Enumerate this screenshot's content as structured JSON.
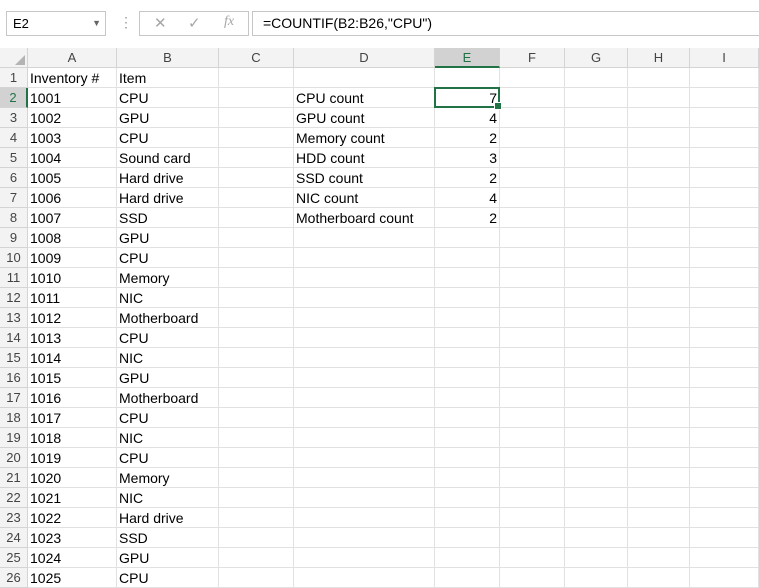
{
  "name_box": "E2",
  "formula_bar": {
    "cancel_icon": "✕",
    "enter_icon": "✓",
    "fx_label": "fx",
    "formula": "=COUNTIF(B2:B26,\"CPU\")"
  },
  "columns": [
    "A",
    "B",
    "C",
    "D",
    "E",
    "F",
    "G",
    "H",
    "I"
  ],
  "rows": [
    "1",
    "2",
    "3",
    "4",
    "5",
    "6",
    "7",
    "8",
    "9",
    "10",
    "11",
    "12",
    "13",
    "14",
    "15",
    "16",
    "17",
    "18",
    "19",
    "20",
    "21",
    "22",
    "23",
    "24",
    "25",
    "26"
  ],
  "col_a": [
    "Inventory #",
    "1001",
    "1002",
    "1003",
    "1004",
    "1005",
    "1006",
    "1007",
    "1008",
    "1009",
    "1010",
    "1011",
    "1012",
    "1013",
    "1014",
    "1015",
    "1016",
    "1017",
    "1018",
    "1019",
    "1020",
    "1021",
    "1022",
    "1023",
    "1024",
    "1025"
  ],
  "col_b": [
    "Item",
    "CPU",
    "GPU",
    "CPU",
    "Sound card",
    "Hard drive",
    "Hard drive",
    "SSD",
    "GPU",
    "CPU",
    "Memory",
    "NIC",
    "Motherboard",
    "CPU",
    "NIC",
    "GPU",
    "Motherboard",
    "CPU",
    "NIC",
    "CPU",
    "Memory",
    "NIC",
    "Hard drive",
    "SSD",
    "GPU",
    "CPU"
  ],
  "summary": [
    {
      "label": "CPU count",
      "value": "7"
    },
    {
      "label": "GPU count",
      "value": "4"
    },
    {
      "label": "Memory count",
      "value": "2"
    },
    {
      "label": "HDD count",
      "value": "3"
    },
    {
      "label": "SSD count",
      "value": "2"
    },
    {
      "label": "NIC count",
      "value": "4"
    },
    {
      "label": "Motherboard count",
      "value": "2"
    }
  ],
  "selected_cell": {
    "column": "E",
    "row": "2"
  },
  "colors": {
    "accent": "#217346",
    "header_bg": "#f3f3f3",
    "gridline": "#e1e1e1"
  }
}
